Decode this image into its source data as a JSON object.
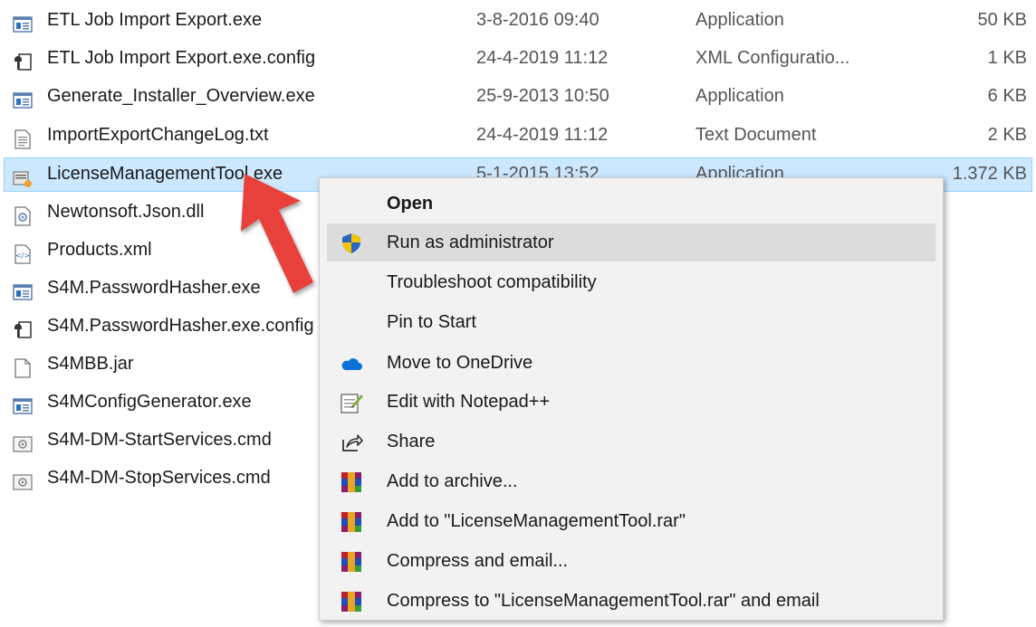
{
  "files": [
    {
      "name": "ETL Job Import Export.exe",
      "date": "3-8-2016 09:40",
      "type": "Application",
      "size": "50 KB",
      "icon": "exe-icon"
    },
    {
      "name": "ETL Job Import Export.exe.config",
      "date": "24-4-2019 11:12",
      "type": "XML Configuratio...",
      "size": "1 KB",
      "icon": "config-icon"
    },
    {
      "name": "Generate_Installer_Overview.exe",
      "date": "25-9-2013 10:50",
      "type": "Application",
      "size": "6 KB",
      "icon": "exe-icon"
    },
    {
      "name": "ImportExportChangeLog.txt",
      "date": "24-4-2019 11:12",
      "type": "Text Document",
      "size": "2 KB",
      "icon": "text-file-icon"
    },
    {
      "name": "LicenseManagementTool.exe",
      "date": "5-1-2015 13:52",
      "type": "Application",
      "size": "1.372 KB",
      "icon": "license-exe-icon"
    },
    {
      "name": "Newtonsoft.Json.dll",
      "date": "",
      "type": "",
      "size": "",
      "icon": "dll-icon"
    },
    {
      "name": "Products.xml",
      "date": "",
      "type": "",
      "size": "",
      "icon": "xml-file-icon"
    },
    {
      "name": "S4M.PasswordHasher.exe",
      "date": "",
      "type": "",
      "size": "",
      "icon": "exe-icon"
    },
    {
      "name": "S4M.PasswordHasher.exe.config",
      "date": "",
      "type": "",
      "size": "",
      "icon": "config-icon"
    },
    {
      "name": "S4MBB.jar",
      "date": "",
      "type": "",
      "size": "",
      "icon": "blank-file-icon"
    },
    {
      "name": "S4MConfigGenerator.exe",
      "date": "",
      "type": "",
      "size": "",
      "icon": "exe-icon"
    },
    {
      "name": "S4M-DM-StartServices.cmd",
      "date": "",
      "type": "",
      "size": "",
      "icon": "cmd-icon"
    },
    {
      "name": "S4M-DM-StopServices.cmd",
      "date": "",
      "type": "",
      "size": "",
      "icon": "cmd-icon"
    }
  ],
  "context_menu": {
    "items": [
      {
        "label": "Open",
        "icon": "",
        "bold": true
      },
      {
        "label": "Run as administrator",
        "icon": "uac-shield-icon",
        "hover": true
      },
      {
        "label": "Troubleshoot compatibility",
        "icon": ""
      },
      {
        "label": "Pin to Start",
        "icon": ""
      },
      {
        "label": "Move to OneDrive",
        "icon": "onedrive-cloud-icon"
      },
      {
        "label": "Edit with Notepad++",
        "icon": "notepad-plus-plus-icon"
      },
      {
        "label": "Share",
        "icon": "share-icon"
      },
      {
        "label": "Add to archive...",
        "icon": "winrar-icon"
      },
      {
        "label": "Add to \"LicenseManagementTool.rar\"",
        "icon": "winrar-icon"
      },
      {
        "label": "Compress and email...",
        "icon": "winrar-icon"
      },
      {
        "label": "Compress to \"LicenseManagementTool.rar\" and email",
        "icon": "winrar-icon"
      }
    ]
  },
  "colors": {
    "selection": "#cce8ff",
    "menu_bg": "#f2f2f2",
    "arrow": "#e8403a"
  }
}
